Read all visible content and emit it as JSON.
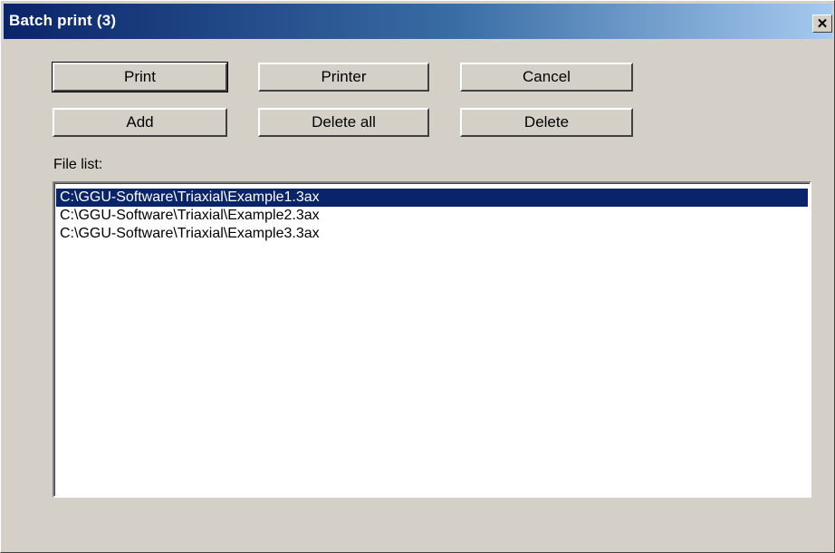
{
  "window": {
    "title": "Batch print (3)",
    "close_symbol": "✕"
  },
  "buttons": {
    "print": "Print",
    "printer": "Printer",
    "cancel": "Cancel",
    "add": "Add",
    "delete_all": "Delete all",
    "delete": "Delete"
  },
  "file_list": {
    "label": "File list:",
    "items": [
      "C:\\GGU-Software\\Triaxial\\Example1.3ax",
      "C:\\GGU-Software\\Triaxial\\Example2.3ax",
      "C:\\GGU-Software\\Triaxial\\Example3.3ax"
    ],
    "selected_index": 0
  },
  "colors": {
    "dialog_bg": "#d4d0c8",
    "title_gradient_start": "#0a246a",
    "title_gradient_end": "#a6caf0",
    "selection_bg": "#0a246a"
  }
}
